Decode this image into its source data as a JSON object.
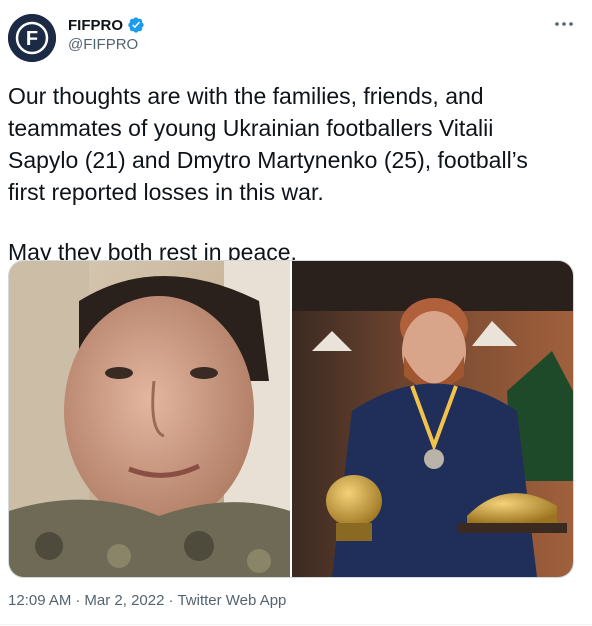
{
  "account": {
    "display_name": "FIFPRO",
    "handle": "@FIFPRO",
    "avatar_letter": "F",
    "verified": true
  },
  "tweet": {
    "paragraph_1": "Our thoughts are with the families, friends, and teammates of young Ukrainian footballers Vitalii Sapylo (21) and Dmytro Martynenko (25), football’s first reported losses in this war.",
    "paragraph_2": "May they both rest in peace."
  },
  "media": {
    "left_photo": "young-man-selfie-camouflage",
    "right_photo": "bearded-man-with-trophies"
  },
  "meta": {
    "time": "12:09 AM",
    "separator_1": "·",
    "date": "Mar 2, 2022",
    "separator_2": "·",
    "source": "Twitter Web App"
  },
  "colors": {
    "text": "#0f1419",
    "secondary": "#536471",
    "verified": "#1d9bf0",
    "avatar_bg": "#1c2a45"
  },
  "icons": {
    "more": "more-horizontal-icon",
    "verified": "verified-badge-icon"
  }
}
